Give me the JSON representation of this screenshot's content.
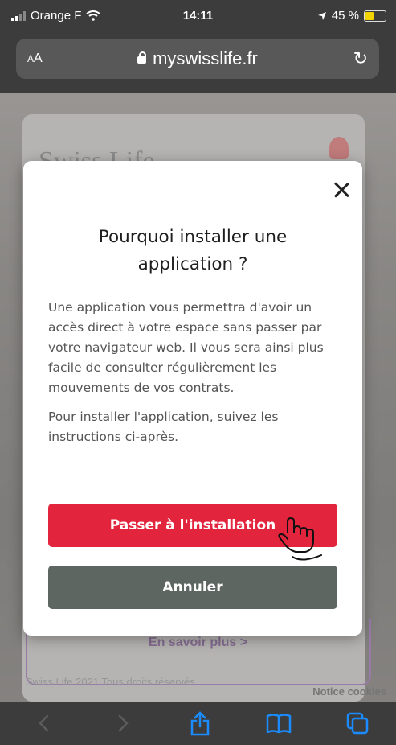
{
  "status_bar": {
    "carrier": "Orange F",
    "time": "14:11",
    "battery": "45 %",
    "battery_level": 0.45
  },
  "browser": {
    "text_size_label_small": "A",
    "text_size_label_large": "A",
    "url": "myswisslife.fr"
  },
  "background_page": {
    "logo_text": "Swiss Life",
    "en_savoir_plus": "En savoir plus >",
    "footer_text": "Swiss Life 2021 Tous droits réservés",
    "notice_cookies": "Notice cookies"
  },
  "modal": {
    "title": "Pourquoi installer une application ?",
    "paragraph1": "Une application vous permettra d'avoir un accès direct à votre espace sans passer par votre navigateur web. Il vous sera ainsi plus facile de consulter régulièrement les mouvements de vos contrats.",
    "paragraph2": "Pour installer l'application, suivez les instructions ci-après.",
    "primary_button": "Passer à l'installation",
    "secondary_button": "Annuler"
  },
  "colors": {
    "primary": "#e2243c",
    "secondary": "#5e6662",
    "browser_chrome": "#3c3c3c",
    "toolbar_active": "#1a8cff"
  },
  "icons": {
    "toolbar": [
      "back-icon",
      "forward-icon",
      "share-icon",
      "bookmarks-icon",
      "tabs-icon"
    ]
  }
}
